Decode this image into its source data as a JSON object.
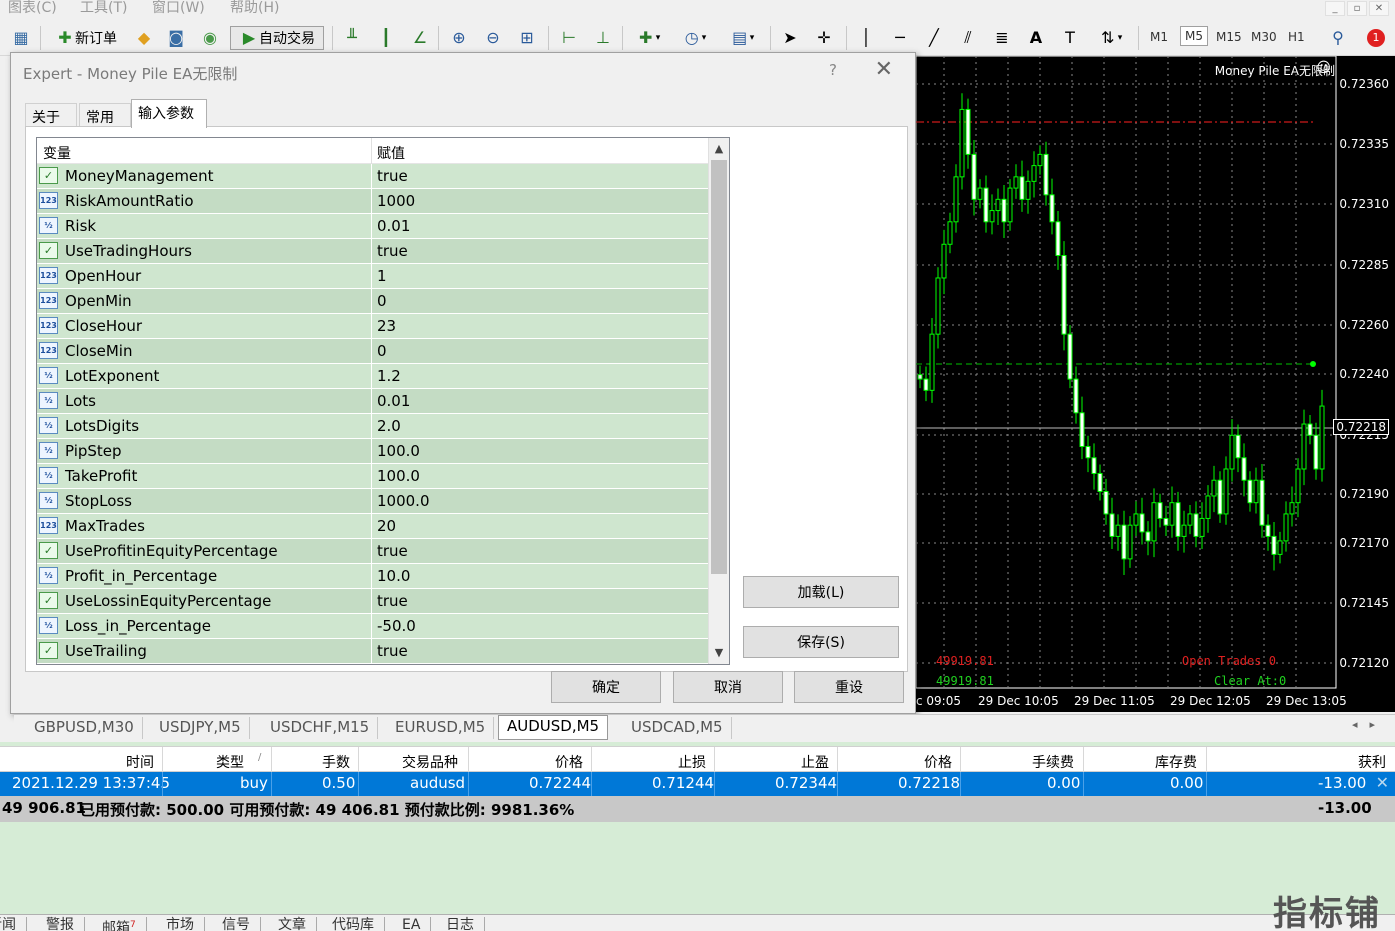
{
  "menu": {
    "items": [
      "图表(C)",
      "工具(T)",
      "窗口(W)",
      "帮助(H)"
    ]
  },
  "toolbar": {
    "new_order_label": "新订单",
    "auto_trade_label": "自动交易",
    "timeframes": [
      "M1",
      "M5",
      "M15",
      "M30",
      "H1"
    ],
    "active_timeframe": "M5",
    "notification_count": "1"
  },
  "chart": {
    "indicator_title": "Money Pile EA无限制",
    "price_labels": [
      "0.72360",
      "0.72335",
      "0.72310",
      "0.72285",
      "0.72260",
      "0.72240",
      "0.72215",
      "0.72190",
      "0.72170",
      "0.72145",
      "0.72120"
    ],
    "current_price": "0.72218",
    "time_labels": [
      "c 09:05",
      "29 Dec 10:05",
      "29 Dec 11:05",
      "29 Dec 12:05",
      "29 Dec 13:05"
    ],
    "corner": {
      "equity_red": "49919.81",
      "equity_green": "49919.81",
      "open_trades": "Open Trades 0",
      "clear_at": "Clear At:0"
    },
    "colors": {
      "candle": "#00ff00",
      "take_profit_line": "#ff2020",
      "entry_line": "#00c000"
    }
  },
  "dialog": {
    "title": "Expert - Money Pile EA无限制",
    "help": "?",
    "tabs": [
      "关于",
      "常用",
      "输入参数"
    ],
    "active_tab": "输入参数",
    "columns": {
      "variable": "变量",
      "value": "赋值"
    },
    "params": [
      {
        "type": "bool",
        "name": "MoneyManagement",
        "value": "true"
      },
      {
        "type": "int",
        "name": "RiskAmountRatio",
        "value": "1000"
      },
      {
        "type": "double",
        "name": "Risk",
        "value": "0.01"
      },
      {
        "type": "bool",
        "name": "UseTradingHours",
        "value": "true"
      },
      {
        "type": "int",
        "name": "OpenHour",
        "value": "1"
      },
      {
        "type": "int",
        "name": "OpenMin",
        "value": "0"
      },
      {
        "type": "int",
        "name": "CloseHour",
        "value": "23"
      },
      {
        "type": "int",
        "name": "CloseMin",
        "value": "0"
      },
      {
        "type": "double",
        "name": "LotExponent",
        "value": "1.2"
      },
      {
        "type": "double",
        "name": "Lots",
        "value": "0.01"
      },
      {
        "type": "double",
        "name": "LotsDigits",
        "value": "2.0"
      },
      {
        "type": "double",
        "name": "PipStep",
        "value": "100.0"
      },
      {
        "type": "double",
        "name": "TakeProfit",
        "value": "100.0"
      },
      {
        "type": "double",
        "name": "StopLoss",
        "value": "1000.0"
      },
      {
        "type": "int",
        "name": "MaxTrades",
        "value": "20"
      },
      {
        "type": "bool",
        "name": "UseProfitinEquityPercentage",
        "value": "true"
      },
      {
        "type": "double",
        "name": "Profit_in_Percentage",
        "value": "10.0"
      },
      {
        "type": "bool",
        "name": "UseLossinEquityPercentage",
        "value": "true"
      },
      {
        "type": "double",
        "name": "Loss_in_Percentage",
        "value": "-50.0"
      },
      {
        "type": "bool",
        "name": "UseTrailing",
        "value": "true"
      }
    ],
    "load_button": "加载(L)",
    "save_button": "保存(S)",
    "ok_button": "确定",
    "cancel_button": "取消",
    "reset_button": "重设"
  },
  "symbol_tabs": [
    "GBPUSD,M30",
    "USDJPY,M5",
    "USDCHF,M15",
    "EURUSD,M5",
    "AUDUSD,M5",
    "USDCAD,M5"
  ],
  "active_symbol_tab": "AUDUSD,M5",
  "trades": {
    "columns": [
      "时间",
      "类型",
      "手数",
      "交易品种",
      "价格",
      "止损",
      "止盈",
      "价格",
      "手续费",
      "库存费",
      "获利"
    ],
    "row": {
      "time": "2021.12.29 13:37:45",
      "type": "buy",
      "lots": "0.50",
      "symbol": "audusd",
      "open_price": "0.72244",
      "sl": "0.71244",
      "tp": "0.72344",
      "price": "0.72218",
      "commission": "0.00",
      "swap": "0.00",
      "profit": "-13.00"
    },
    "summary": {
      "balance": "49 906.81",
      "text": "已用预付款: 500.00  可用预付款: 49 406.81  预付款比例: 9981.36%",
      "profit": "-13.00"
    }
  },
  "bottom_tabs": [
    "新闻",
    "警报",
    "邮箱",
    "市场",
    "信号",
    "文章",
    "代码库",
    "EA",
    "日志"
  ],
  "mailbox_badge": "7",
  "watermark": "指标铺"
}
